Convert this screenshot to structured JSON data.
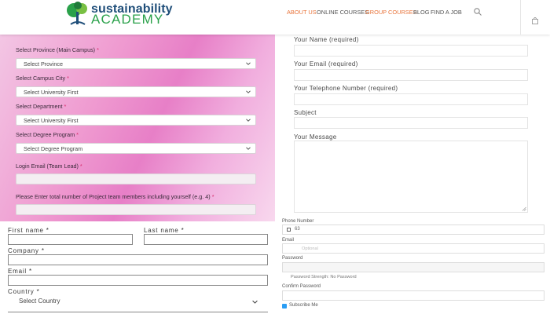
{
  "header": {
    "logo_line1": "sustainability",
    "logo_line2": "ACADEMY",
    "nav": [
      {
        "label": "ABOUT US",
        "active": true
      },
      {
        "label": "ONLINE COURSES",
        "active": false
      },
      {
        "label": "GROUP COURSES",
        "active": true
      },
      {
        "label": "BLOG",
        "active": false
      },
      {
        "label": "FIND A JOB",
        "active": false
      }
    ],
    "search_icon": "search-icon",
    "cart_icon": "bag-icon"
  },
  "group_form": {
    "province_label": "Select Province (Main Campus)",
    "province_value": "Select Province",
    "city_label": "Select Campus City",
    "city_value": "Select University First",
    "department_label": "Select Department",
    "department_value": "Select University First",
    "degree_label": "Select Degree Program",
    "degree_value": "Select Degree Program",
    "email_label": "Login Email (Team Lead)",
    "members_label": "Please Enter total number of Project team members including yourself (e.g. 4)",
    "required_mark": "*"
  },
  "contact_form": {
    "name_label": "Your Name (required)",
    "email_label": "Your Email (required)",
    "phone_label": "Your Telephone Number (required)",
    "subject_label": "Subject",
    "message_label": "Your Message"
  },
  "registration": {
    "first_name_label": "First name *",
    "last_name_label": "Last name *",
    "company_label": "Company *",
    "email_label": "Email *",
    "country_label": "Country *",
    "country_value": "Select Country"
  },
  "account": {
    "phone_label": "Phone Number",
    "phone_code": "63",
    "email_label": "Email",
    "email_placeholder": "Optional",
    "password_label": "Password",
    "password_strength": "Password Strength: No Password",
    "confirm_label": "Confirm Password",
    "subscribe_label": "Subscribe Me"
  },
  "colors": {
    "accent": "#e8733a",
    "logo_blue": "#1f4e79",
    "logo_green": "#2aa14a",
    "required": "#d62b6a"
  }
}
